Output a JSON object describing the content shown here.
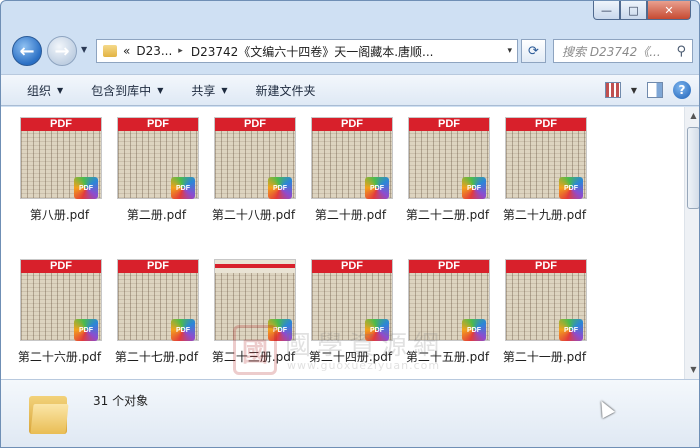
{
  "window": {
    "controls": {
      "minimize": "—",
      "maximize": "□",
      "close": "✕"
    }
  },
  "nav": {
    "back_icon": "arrow-left-icon",
    "forward_icon": "arrow-right-icon",
    "address": {
      "prefix": "«",
      "segment1": "D23...",
      "separator": "▸",
      "segment2": "D23742《文编六十四卷》天一阁藏本.唐顺...",
      "dropdown": "▾"
    },
    "refresh": "⟳",
    "search_placeholder": "搜索 D23742《...",
    "search_icon": "🔍"
  },
  "toolbar": {
    "organize": "组织",
    "include": "包含到库中",
    "share": "共享",
    "new_folder": "新建文件夹",
    "dd": "▼"
  },
  "files": [
    {
      "name": "第八册.pdf",
      "slim_header": false
    },
    {
      "name": "第二册.pdf",
      "slim_header": false
    },
    {
      "name": "第二十八册.pdf",
      "slim_header": false
    },
    {
      "name": "第二十册.pdf",
      "slim_header": false
    },
    {
      "name": "第二十二册.pdf",
      "slim_header": false
    },
    {
      "name": "第二十九册.pdf",
      "slim_header": false
    },
    {
      "name": "第二十六册.pdf",
      "slim_header": false
    },
    {
      "name": "第二十七册.pdf",
      "slim_header": false
    },
    {
      "name": "第二十三册.pdf",
      "slim_header": true
    },
    {
      "name": "第二十四册.pdf",
      "slim_header": false
    },
    {
      "name": "第二十五册.pdf",
      "slim_header": false
    },
    {
      "name": "第二十一册.pdf",
      "slim_header": false
    }
  ],
  "pdf_label": "PDF",
  "badge_label": "PDF",
  "watermark": {
    "seal": "國",
    "text": "國學資源網",
    "url": "www.guoxueziyuan.com"
  },
  "status": {
    "count": "31 个对象"
  },
  "scroll": {
    "up": "▲",
    "down": "▼"
  }
}
